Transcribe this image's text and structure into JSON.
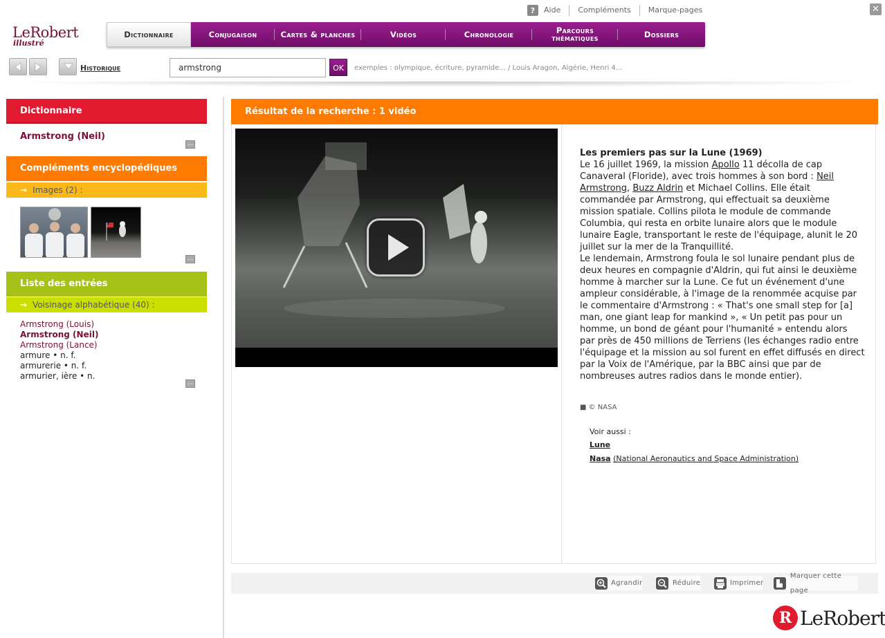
{
  "util": {
    "help_icon": "?",
    "help": "Aide",
    "complements": "Compléments",
    "bookmarks": "Marque-pages",
    "close": "✕"
  },
  "logo": {
    "line1": "LeRobert",
    "line2": "illustré"
  },
  "nav": {
    "tabs": [
      {
        "label": "Dictionnaire",
        "active": true
      },
      {
        "label": "Conjugaison"
      },
      {
        "label": "Cartes & planches"
      },
      {
        "label": "Vidéos"
      },
      {
        "label": "Chronologie"
      },
      {
        "label": "Parcours thématiques"
      },
      {
        "label": "Dossiers"
      }
    ]
  },
  "toolbar": {
    "history": "Historique",
    "search_value": "armstrong",
    "ok": "OK",
    "examples": "exemples : olympique, écriture, pyramide... / Louis Aragon, Algérie, Henri 4..."
  },
  "sidebar": {
    "dictionary_header": "Dictionnaire",
    "dictionary_entry": "Armstrong (Neil)",
    "more": "...",
    "complements_header": "Compléments encyclopédiques",
    "images_sub": "Images (2) :",
    "arrow": "→",
    "entries_header": "Liste des entrées",
    "neighbors_sub": "Voisinage alphabétique (40) :",
    "entries": [
      {
        "text": "Armstrong (Louis)",
        "type": "link"
      },
      {
        "text": "Armstrong (Neil)",
        "type": "cur"
      },
      {
        "text": "Armstrong (Lance)",
        "type": "link"
      },
      {
        "text": "armure • n. f.",
        "type": "plain"
      },
      {
        "text": "armurerie • n. f.",
        "type": "plain"
      },
      {
        "text": "armurier, ière • n.",
        "type": "plain"
      }
    ]
  },
  "result": {
    "header": "Résultat de la recherche : 1 vidéo",
    "article": {
      "title": "Les premiers pas sur la Lune (1969)",
      "p1_a": "Le 16 juillet 1969, la mission ",
      "link_apollo": "Apollo",
      "p1_b": " 11 décolla de cap Canaveral (Floride), avec trois hommes à son bord : ",
      "link_neil": "Neil Armstrong",
      "p1_c": ", ",
      "link_buzz": "Buzz Aldrin",
      "p1_d": " et Michael Collins. Elle était commandée par Armstrong, qui effectuait sa deuxième mission spatiale. Collins pilota le module de commande Columbia, qui resta en orbite lunaire alors que le module lunaire Eagle, transportant le reste de l'équipage, alunit le 20 juillet sur la mer de la Tranquillité.",
      "p2": "Le lendemain, Armstrong foula le sol lunaire pendant plus de deux heures en compagnie d'Aldrin, qui fut ainsi le deuxième homme à marcher sur la Lune. Ce fut un événement d'une ampleur considérable, à l'image de la renommée acquise par le commentaire d'Armstrong : « That's one small step for [a] man, one giant leap for mankind », « Un petit pas pour un homme, un bond de géant pour l'humanité » entendu alors par près de 450 millions de Terriens (les échanges radio entre l'équipage et la mission au sol furent en effet diffusés en direct par la Voix de l'Amérique, par la BBC ainsi que par de nombreuses autres radios dans le monde entier)."
    },
    "credit": "■ © NASA",
    "see_also": "Voir aussi :",
    "see_lune": "Lune",
    "see_nasa": "Nasa",
    "see_nasa_full": "(National Aeronautics and Space Administration)"
  },
  "actions": {
    "zoom_in": "Agrandir",
    "zoom_out": "Réduire",
    "print": "Imprimer",
    "bookmark": "Marquer cette page"
  },
  "brand": {
    "mark": "R",
    "name": "LeRobert"
  }
}
